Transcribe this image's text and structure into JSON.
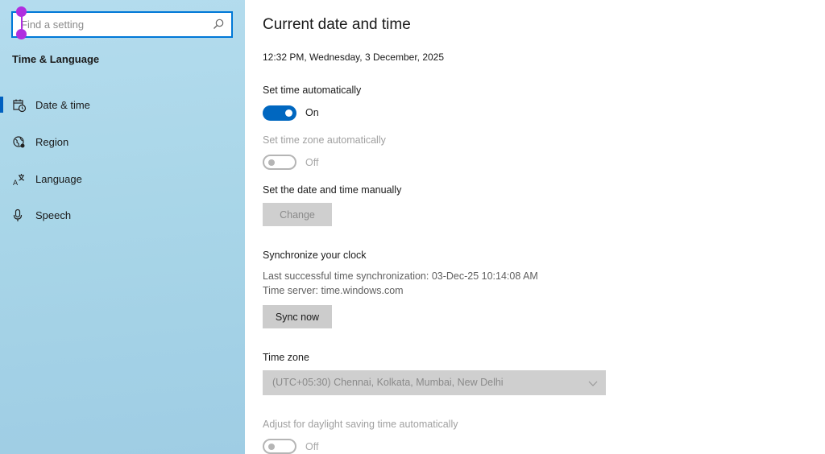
{
  "sidebar": {
    "search": {
      "placeholder": "Find a setting"
    },
    "heading": "Time & Language",
    "items": [
      {
        "label": "Date & time",
        "icon": "calendar-clock-icon",
        "selected": true
      },
      {
        "label": "Region",
        "icon": "globe-icon",
        "selected": false
      },
      {
        "label": "Language",
        "icon": "language-icon",
        "selected": false
      },
      {
        "label": "Speech",
        "icon": "microphone-icon",
        "selected": false
      }
    ]
  },
  "main": {
    "title": "Current date and time",
    "current_datetime": "12:32 PM, Wednesday, 3 December, 2025",
    "set_time_auto": {
      "label": "Set time automatically",
      "state": "On"
    },
    "set_timezone_auto": {
      "label": "Set time zone automatically",
      "state": "Off"
    },
    "manual": {
      "label": "Set the date and time manually",
      "button": "Change"
    },
    "sync": {
      "label": "Synchronize your clock",
      "last_sync": "Last successful time synchronization: 03-Dec-25 10:14:08 AM",
      "server": "Time server: time.windows.com",
      "button": "Sync now"
    },
    "timezone": {
      "label": "Time zone",
      "value": "(UTC+05:30) Chennai, Kolkata, Mumbai, New Delhi"
    },
    "dst": {
      "label": "Adjust for daylight saving time automatically",
      "state": "Off"
    }
  },
  "colors": {
    "accent": "#0067c0",
    "sidebar_bg": "#a9d6e8",
    "selection_handle": "#b02ee0"
  }
}
